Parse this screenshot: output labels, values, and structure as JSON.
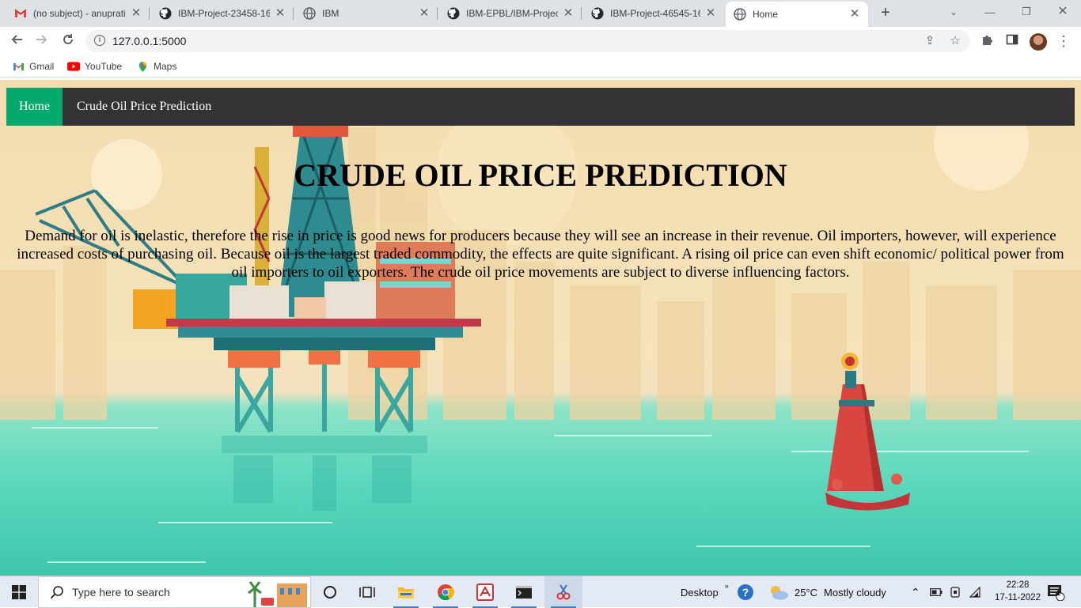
{
  "browser": {
    "tabs": [
      {
        "title": "(no subject) - anuprati",
        "icon": "gmail-icon",
        "active": false
      },
      {
        "title": "IBM-Project-23458-16",
        "icon": "github-icon",
        "active": false
      },
      {
        "title": "IBM",
        "icon": "globe-icon",
        "active": false
      },
      {
        "title": "IBM-EPBL/IBM-Project",
        "icon": "github-icon",
        "active": false
      },
      {
        "title": "IBM-Project-46545-16",
        "icon": "github-icon",
        "active": false
      },
      {
        "title": "Home",
        "icon": "globe-icon",
        "active": true
      }
    ],
    "url": "127.0.0.1:5000",
    "bookmarks": [
      {
        "label": "Gmail",
        "icon": "gmail-icon"
      },
      {
        "label": "YouTube",
        "icon": "youtube-icon"
      },
      {
        "label": "Maps",
        "icon": "maps-icon"
      }
    ]
  },
  "page": {
    "nav": {
      "home": "Home",
      "title": "Crude Oil Price Prediction"
    },
    "heading": "CRUDE OIL PRICE PREDICTION",
    "paragraph": "Demand for oil is inelastic, therefore the rise in price is good news for producers because they will see an increase in their revenue. Oil importers, however, will experience increased costs of purchasing oil. Because oil is the largest traded commodity, the effects are quite significant. A rising oil price can even shift economic/ political power from oil importers to oil exporters. The crude oil price movements are subject to diverse influencing factors."
  },
  "taskbar": {
    "search_placeholder": "Type here to search",
    "desktop_label": "Desktop",
    "weather": {
      "temp": "25°C",
      "condition": "Mostly cloudy"
    },
    "time": "22:28",
    "date": "17-11-2022",
    "notification_count": "1"
  },
  "colors": {
    "nav_bg": "#333333",
    "home_bg": "#04aa6d",
    "chrome_frame": "#dee1e6"
  }
}
